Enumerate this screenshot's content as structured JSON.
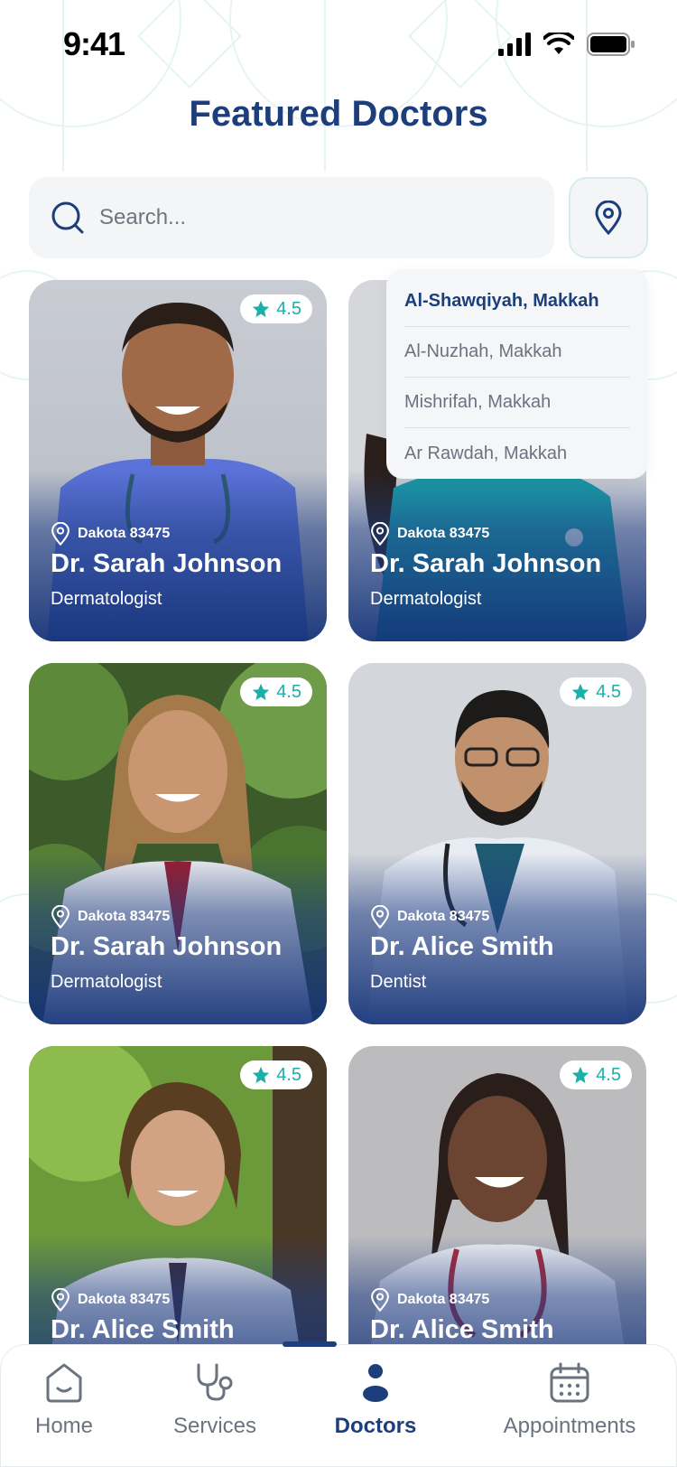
{
  "status": {
    "time": "9:41"
  },
  "header": {
    "title": "Featured Doctors"
  },
  "search": {
    "placeholder": "Search..."
  },
  "location_dropdown": {
    "options": [
      "Al-Shawqiyah, Makkah",
      "Al-Nuzhah, Makkah",
      "Mishrifah, Makkah",
      "Ar Rawdah, Makkah"
    ],
    "selected_index": 0
  },
  "doctors": [
    {
      "name": "Dr. Sarah Johnson",
      "specialty": "Dermatologist",
      "location": "Dakota 83475",
      "rating": "4.5"
    },
    {
      "name": "Dr. Sarah Johnson",
      "specialty": "Dermatologist",
      "location": "Dakota 83475",
      "rating": "4.5"
    },
    {
      "name": "Dr. Sarah Johnson",
      "specialty": "Dermatologist",
      "location": "Dakota 83475",
      "rating": "4.5"
    },
    {
      "name": "Dr. Alice Smith",
      "specialty": "Dentist",
      "location": "Dakota 83475",
      "rating": "4.5"
    },
    {
      "name": "Dr. Alice Smith",
      "specialty": "",
      "location": "Dakota 83475",
      "rating": "4.5"
    },
    {
      "name": "Dr. Alice Smith",
      "specialty": "",
      "location": "Dakota 83475",
      "rating": "4.5"
    }
  ],
  "tabs": [
    {
      "label": "Home",
      "icon": "home-icon"
    },
    {
      "label": "Services",
      "icon": "stethoscope-icon"
    },
    {
      "label": "Doctors",
      "icon": "person-icon"
    },
    {
      "label": "Appointments",
      "icon": "calendar-icon"
    }
  ],
  "active_tab": "Doctors",
  "colors": {
    "primary": "#1c3f7c",
    "accent": "#1bb0a8",
    "surface": "#f3f5f7"
  }
}
